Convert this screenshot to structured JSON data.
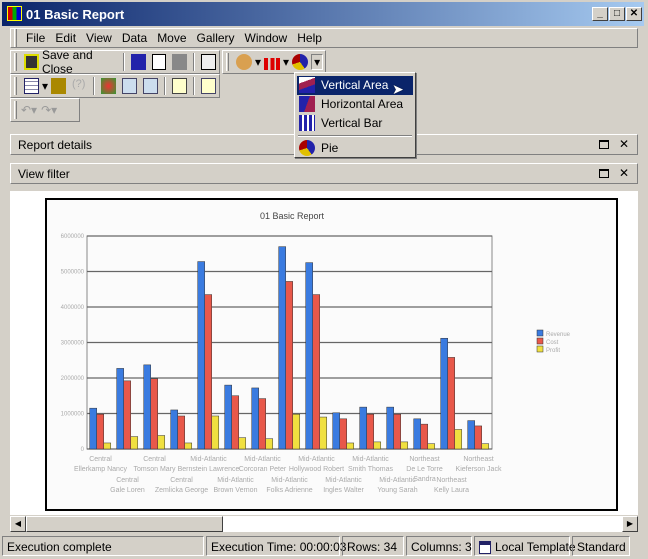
{
  "window": {
    "title": "01 Basic Report"
  },
  "menu": [
    "File",
    "Edit",
    "View",
    "Data",
    "Move",
    "Gallery",
    "Window",
    "Help"
  ],
  "toolbar": {
    "save_close": "Save and Close"
  },
  "chart_menu": {
    "items": [
      {
        "label": "Vertical Area",
        "icon": "vertical-area-icon",
        "selected": true
      },
      {
        "label": "Horizontal Area",
        "icon": "horizontal-area-icon"
      },
      {
        "label": "Vertical Bar",
        "icon": "vertical-bar-icon"
      },
      {
        "label": "Pie",
        "icon": "pie-icon"
      }
    ]
  },
  "panels": {
    "report_details": "Report details",
    "view_filter": "View filter"
  },
  "status": {
    "message": "Execution complete",
    "exec_time": "Execution Time: 00:00:03",
    "rows": "Rows: 34",
    "columns": "Columns: 3",
    "template": "Local Template",
    "mode": "Standard"
  },
  "chart_data": {
    "type": "bar",
    "title": "01 Basic Report",
    "ylim": [
      0,
      6000000
    ],
    "yticks": [
      "0",
      "1000000",
      "2000000",
      "3000000",
      "4000000",
      "5000000",
      "6000000"
    ],
    "grid": true,
    "legend": "right",
    "categories": [
      "Central Ellerkamp Nancy",
      "Central Gale Loren",
      "Central Tomson Mary",
      "Central Zemlicka George",
      "Mid-Atlantic Bernstein Lawrence",
      "Mid-Atlantic Brown Vernon",
      "Mid-Atlantic Corcoran Peter",
      "Mid-Atlantic Folks Adrienne",
      "Mid-Atlantic Hollywood Robert",
      "Mid-Atlantic Ingles Walter",
      "Mid-Atlantic Smith Thomas",
      "Mid-Atlantic Young Sarah",
      "Northeast De Le Torre Sandra",
      "Northeast Kelly Laura",
      "Northeast Kieferson Jack"
    ],
    "series": [
      {
        "name": "Revenue",
        "color": "#3a7be0",
        "values": [
          1150000,
          2270000,
          2370000,
          1100000,
          5280000,
          1800000,
          1720000,
          5700000,
          5250000,
          1020000,
          1180000,
          1180000,
          850000,
          3120000,
          800000
        ]
      },
      {
        "name": "Cost",
        "color": "#e8584a",
        "values": [
          980000,
          1920000,
          1980000,
          930000,
          4350000,
          1500000,
          1420000,
          4720000,
          4350000,
          850000,
          980000,
          980000,
          700000,
          2580000,
          650000
        ]
      },
      {
        "name": "Profit",
        "color": "#f0e040",
        "values": [
          170000,
          350000,
          380000,
          170000,
          930000,
          320000,
          290000,
          980000,
          900000,
          170000,
          200000,
          200000,
          150000,
          550000,
          150000
        ]
      }
    ]
  }
}
